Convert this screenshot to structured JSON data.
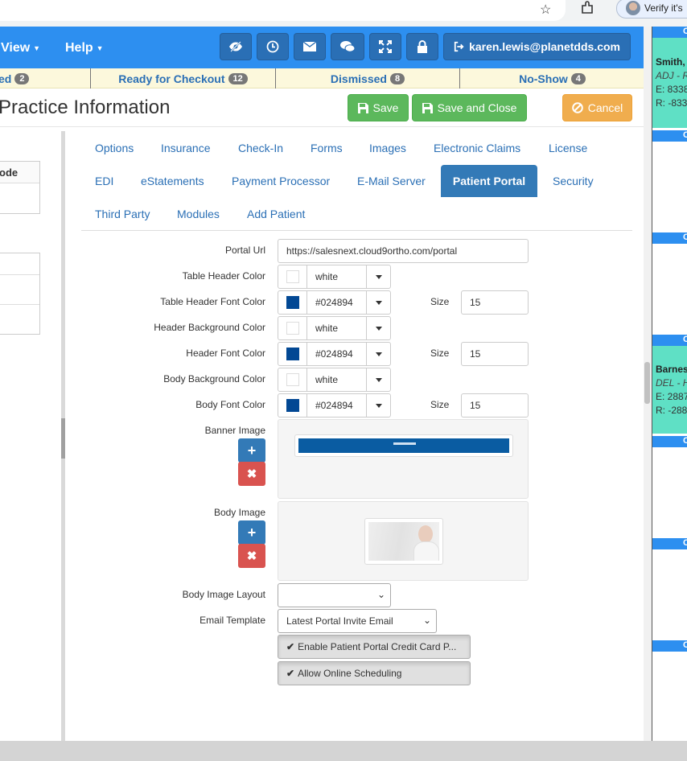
{
  "browser": {
    "verify_label": "Verify it's"
  },
  "nav": {
    "menus": [
      {
        "label": "View"
      },
      {
        "label": "Help"
      }
    ],
    "user_email": "karen.lewis@planetdds.com"
  },
  "statusbar": {
    "items": [
      {
        "label": "ed",
        "count": "2"
      },
      {
        "label": "Ready for Checkout",
        "count": "12"
      },
      {
        "label": "Dismissed",
        "count": "8"
      },
      {
        "label": "No-Show",
        "count": "4"
      }
    ]
  },
  "page": {
    "title": "Practice Information",
    "save_label": "Save",
    "save_close_label": "Save and Close",
    "cancel_label": "Cancel"
  },
  "left_panel": {
    "header": "ode"
  },
  "tabs": [
    {
      "label": "Options"
    },
    {
      "label": "Insurance"
    },
    {
      "label": "Check-In"
    },
    {
      "label": "Forms"
    },
    {
      "label": "Images"
    },
    {
      "label": "Electronic Claims"
    },
    {
      "label": "License"
    },
    {
      "label": "EDI"
    },
    {
      "label": "eStatements"
    },
    {
      "label": "Payment Processor"
    },
    {
      "label": "E-Mail Server"
    },
    {
      "label": "Patient Portal"
    },
    {
      "label": "Security"
    },
    {
      "label": "Third Party"
    },
    {
      "label": "Modules"
    },
    {
      "label": "Add Patient"
    }
  ],
  "form": {
    "portal_url": {
      "label": "Portal Url",
      "value": "https://salesnext.cloud9ortho.com/portal"
    },
    "table_header_color": {
      "label": "Table Header Color",
      "value": "white",
      "swatch": "#ffffff"
    },
    "table_header_font_color": {
      "label": "Table Header Font Color",
      "value": "#024894",
      "swatch": "#024894",
      "size_label": "Size",
      "size": "15"
    },
    "header_background_color": {
      "label": "Header Background Color",
      "value": "white",
      "swatch": "#ffffff"
    },
    "header_font_color": {
      "label": "Header Font Color",
      "value": "#024894",
      "swatch": "#024894",
      "size_label": "Size",
      "size": "15"
    },
    "body_background_color": {
      "label": "Body Background Color",
      "value": "white",
      "swatch": "#ffffff"
    },
    "body_font_color": {
      "label": "Body Font Color",
      "value": "#024894",
      "swatch": "#024894",
      "size_label": "Size",
      "size": "15"
    },
    "banner_image": {
      "label": "Banner Image"
    },
    "body_image": {
      "label": "Body Image"
    },
    "body_image_layout": {
      "label": "Body Image Layout",
      "value": ""
    },
    "email_template": {
      "label": "Email Template",
      "value": "Latest Portal Invite Email"
    },
    "enable_credit_card": {
      "label": "Enable Patient Portal Credit Card P..."
    },
    "allow_online_scheduling": {
      "label": "Allow Online Scheduling"
    }
  },
  "side_panel": {
    "header_letter": "C",
    "cards": [
      {
        "name": "Smith,",
        "sub": "ADJ - R",
        "line1": "E: 8338",
        "line2": "R: -833"
      },
      {
        "name": "Barnes",
        "sub": "DEL - H",
        "line1": "E: 2887",
        "line2": "R: -288"
      }
    ]
  },
  "colors": {
    "navbar": "#2d8ff0",
    "active_tab": "#337ab7",
    "success": "#5cb85c",
    "warning": "#f0ad4e",
    "danger": "#d9534f",
    "status_bg": "#fcf8dc",
    "card": "#5fe0c5"
  }
}
